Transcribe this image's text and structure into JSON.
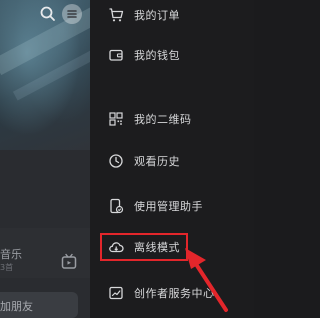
{
  "background_page": {
    "music_label": "音乐",
    "music_sub": "3首",
    "friend_label": "加朋友"
  },
  "drawer": {
    "items": [
      {
        "label": "我的订单",
        "icon": "cart-icon"
      },
      {
        "label": "我的钱包",
        "icon": "wallet-icon"
      },
      {
        "label": "我的二维码",
        "icon": "qr-code-icon"
      },
      {
        "label": "观看历史",
        "icon": "clock-icon"
      },
      {
        "label": "使用管理助手",
        "icon": "phone-shield-icon"
      },
      {
        "label": "离线模式",
        "icon": "cloud-download-icon"
      },
      {
        "label": "创作者服务中心",
        "icon": "chart-icon"
      }
    ]
  },
  "annotation": {
    "highlight_color": "#e3262b"
  }
}
